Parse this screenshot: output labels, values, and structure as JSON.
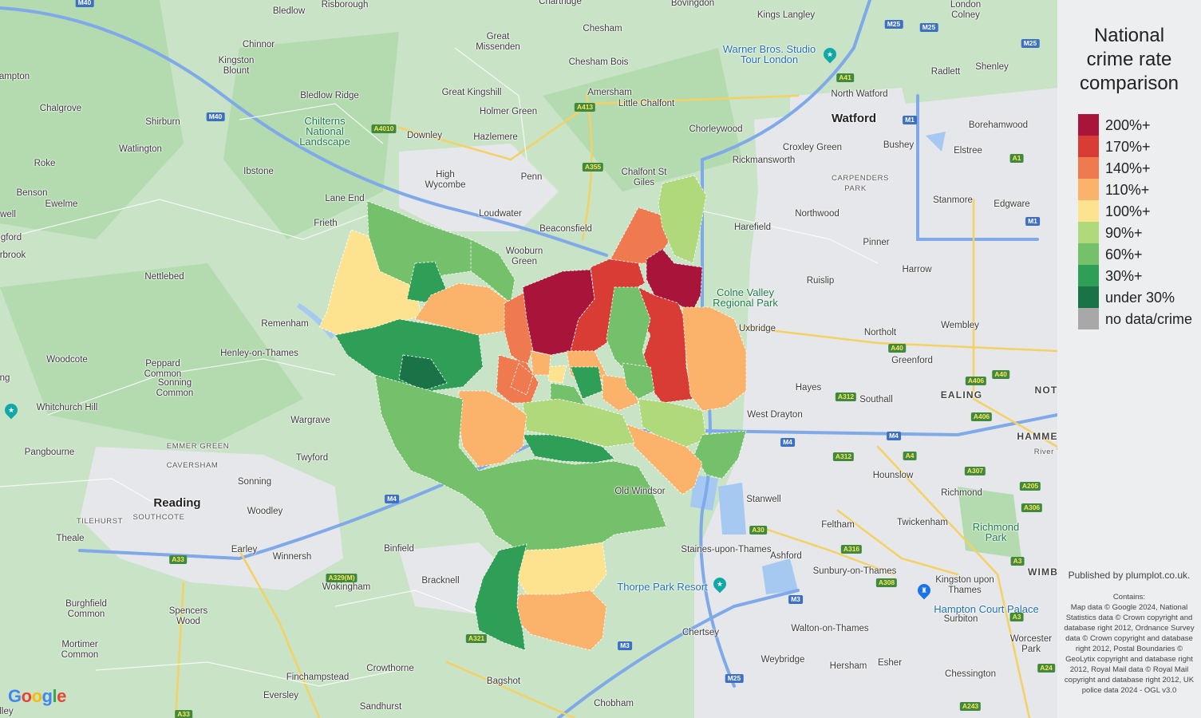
{
  "legend": {
    "title_lines": [
      "National",
      "crime rate",
      "comparison"
    ],
    "items": [
      {
        "label": "200%+",
        "color": "#a8143a"
      },
      {
        "label": "170%+",
        "color": "#d93c35"
      },
      {
        "label": "140%+",
        "color": "#f07a4f"
      },
      {
        "label": "110%+",
        "color": "#fbb36b"
      },
      {
        "label": "100%+",
        "color": "#fde38f"
      },
      {
        "label": "90%+",
        "color": "#afd97a"
      },
      {
        "label": "60%+",
        "color": "#74c06b"
      },
      {
        "label": "30%+",
        "color": "#2f9e56"
      },
      {
        "label": "under 30%",
        "color": "#1a7346"
      },
      {
        "label": "no data/crime",
        "color": "#a8a8a8"
      }
    ]
  },
  "credits": {
    "publisher": "Published by plumplot.co.uk.",
    "contains": "Contains:\nMap data © Google 2024, National Statistics data © Crown copyright and database right 2012, Ordnance Survey data © Crown copyright and database right 2012, Postal Boundaries © GeoLytix copyright and database right 2012, Royal Mail data © Royal Mail copyright and database right 2012, UK police data 2024 - OGL v3.0"
  },
  "map": {
    "logo": "Google",
    "places": [
      {
        "name": "Bledlow"
      },
      {
        "name": "Risborough"
      },
      {
        "name": "Chartridge"
      },
      {
        "name": "Bovingdon"
      },
      {
        "name": "Kings Langley"
      },
      {
        "name": "London Colney"
      },
      {
        "name": "Chinnor"
      },
      {
        "name": "Great Missenden"
      },
      {
        "name": "Chesham"
      },
      {
        "name": "Kingston Blount"
      },
      {
        "name": "Chesham Bois"
      },
      {
        "name": "Radlett"
      },
      {
        "name": "Shenley"
      },
      {
        "name": "ampton"
      },
      {
        "name": "Amersham"
      },
      {
        "name": "Great Kingshill"
      },
      {
        "name": "North Watford"
      },
      {
        "name": "Chalgrove"
      },
      {
        "name": "Bledlow Ridge"
      },
      {
        "name": "Little Chalfont"
      },
      {
        "name": "Holmer Green"
      },
      {
        "name": "Shirburn"
      },
      {
        "name": "Watford"
      },
      {
        "name": "Borehamwood"
      },
      {
        "name": "Chorleywood"
      },
      {
        "name": "Downley"
      },
      {
        "name": "Watlington"
      },
      {
        "name": "Hazlemere"
      },
      {
        "name": "Croxley Green"
      },
      {
        "name": "Bushey"
      },
      {
        "name": "Elstree"
      },
      {
        "name": "Rickmansworth"
      },
      {
        "name": "Roke"
      },
      {
        "name": "Ibstone"
      },
      {
        "name": "High Wycombe"
      },
      {
        "name": "Penn"
      },
      {
        "name": "Chalfont St Giles"
      },
      {
        "name": "Benson"
      },
      {
        "name": "Lane End"
      },
      {
        "name": "Ewelme"
      },
      {
        "name": "Stanmore"
      },
      {
        "name": "Edgware"
      },
      {
        "name": "Loudwater"
      },
      {
        "name": "Northwood"
      },
      {
        "name": "well"
      },
      {
        "name": "Frieth"
      },
      {
        "name": "Beaconsfield"
      },
      {
        "name": "Harefield"
      },
      {
        "name": "gford"
      },
      {
        "name": "Pinner"
      },
      {
        "name": "rbrook"
      },
      {
        "name": "Wooburn Green"
      },
      {
        "name": "Harrow"
      },
      {
        "name": "Nettlebed"
      },
      {
        "name": "Ruislip"
      },
      {
        "name": "Remenham"
      },
      {
        "name": "Uxbridge"
      },
      {
        "name": "Wembley"
      },
      {
        "name": "Northolt"
      },
      {
        "name": "Henley-on-Thames"
      },
      {
        "name": "Woodcote"
      },
      {
        "name": "Greenford"
      },
      {
        "name": "Peppard Common"
      },
      {
        "name": "Hayes"
      },
      {
        "name": "Sonning Common"
      },
      {
        "name": "Southall"
      },
      {
        "name": "ng"
      },
      {
        "name": "Whitchurch Hill"
      },
      {
        "name": "West Drayton"
      },
      {
        "name": "Wargrave"
      },
      {
        "name": "Pangbourne"
      },
      {
        "name": "Twyford"
      },
      {
        "name": "Hounslow"
      },
      {
        "name": "Sonning"
      },
      {
        "name": "Richmond"
      },
      {
        "name": "Old Windsor"
      },
      {
        "name": "Stanwell"
      },
      {
        "name": "Reading"
      },
      {
        "name": "SOUTHCOTE"
      },
      {
        "name": "Woodley"
      },
      {
        "name": "TILEHURST"
      },
      {
        "name": "Feltham"
      },
      {
        "name": "Twickenham"
      },
      {
        "name": "Theale"
      },
      {
        "name": "Earley"
      },
      {
        "name": "Binfield"
      },
      {
        "name": "Staines-upon-Thames"
      },
      {
        "name": "Winnersh"
      },
      {
        "name": "Ashford"
      },
      {
        "name": "Sunbury-on-Thames"
      },
      {
        "name": "Bracknell"
      },
      {
        "name": "Burghfield Common"
      },
      {
        "name": "Wokingham"
      },
      {
        "name": "Kingston upon Thames"
      },
      {
        "name": "Spencers Wood"
      },
      {
        "name": "Surbiton"
      },
      {
        "name": "Chertsey"
      },
      {
        "name": "Walton-on-Thames"
      },
      {
        "name": "Worcester Park"
      },
      {
        "name": "Mortimer Common"
      },
      {
        "name": "Weybridge"
      },
      {
        "name": "Hersham"
      },
      {
        "name": "Esher"
      },
      {
        "name": "Crowthorne"
      },
      {
        "name": "Chessington"
      },
      {
        "name": "Finchampstead"
      },
      {
        "name": "Bagshot"
      },
      {
        "name": "Eversley"
      },
      {
        "name": "Sandhurst"
      },
      {
        "name": "Chobham"
      },
      {
        "name": "lley"
      },
      {
        "name": "Chilterns National Landscape"
      },
      {
        "name": "Colne Valley Regional Park"
      },
      {
        "name": "Richmond Park"
      },
      {
        "name": "Warner Bros. Studio Tour London"
      },
      {
        "name": "Thorpe Park Resort"
      },
      {
        "name": "Hampton Court Palace"
      },
      {
        "name": "EALING"
      },
      {
        "name": "NOT"
      },
      {
        "name": "HAMME"
      },
      {
        "name": "WIMB"
      },
      {
        "name": "EMMER GREEN"
      },
      {
        "name": "CAVERSHAM"
      },
      {
        "name": "CARPENDERS PARK"
      },
      {
        "name": "River Th"
      }
    ],
    "roads": [
      "M40",
      "M40",
      "M25",
      "M25",
      "M25",
      "A41",
      "M1",
      "A413",
      "A355",
      "A4010",
      "A40",
      "A40",
      "A406",
      "A406",
      "A312",
      "A312",
      "M4",
      "M4",
      "M4",
      "A4",
      "A307",
      "A205",
      "A306",
      "A329(M)",
      "A33",
      "A30",
      "A316",
      "A308",
      "M3",
      "M3",
      "A3",
      "A3",
      "A24",
      "A243",
      "A1",
      "M1",
      "A321",
      "A33",
      "M25"
    ]
  }
}
